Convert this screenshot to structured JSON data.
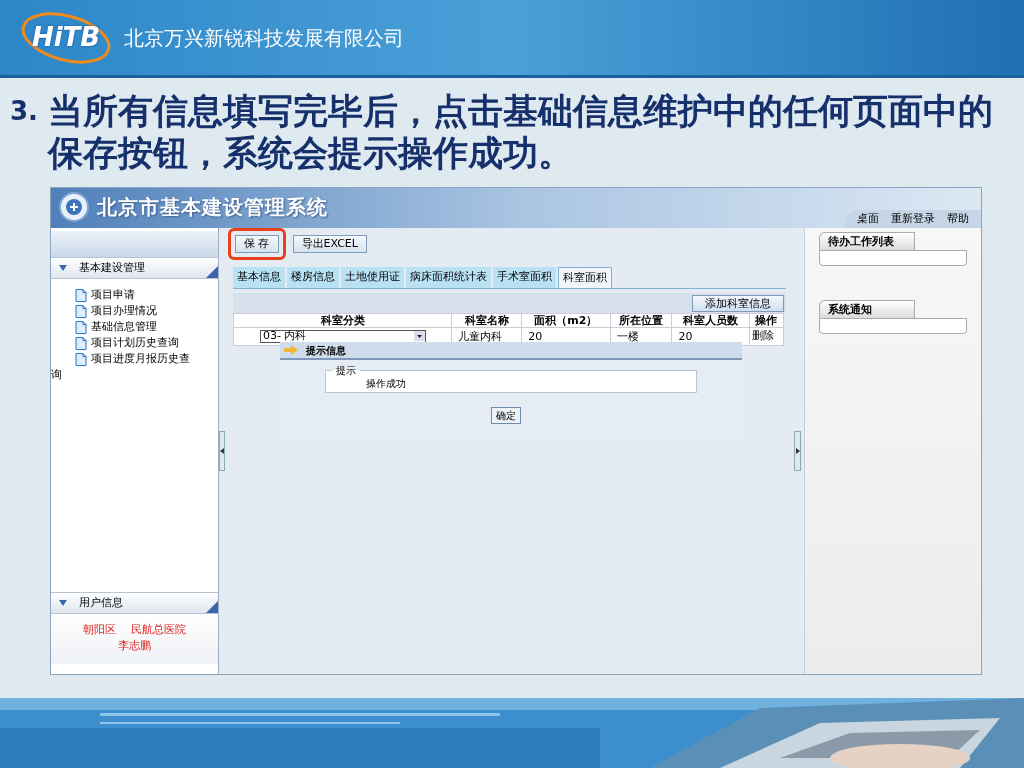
{
  "company": {
    "logo_text": "HiTB",
    "name": "北京万兴新锐科技发展有限公司"
  },
  "heading": {
    "number": "3.",
    "text": "当所有信息填写完毕后，点击基础信息维护中的任何页面中的保存按钮，系统会提示操作成功。"
  },
  "app": {
    "title": "北京市基本建设管理系统",
    "nav_links": [
      "桌面",
      "重新登录",
      "帮助"
    ],
    "sidebar": {
      "sections": [
        {
          "title": "基本建设管理",
          "expanded": true,
          "items": [
            "项目申请",
            "项目办理情况",
            "基础信息管理",
            "项目计划历史查询",
            "项目进度月报历史查询"
          ]
        }
      ],
      "user_section": {
        "title": "用户信息",
        "expanded": true,
        "lines": [
          "朝阳区　 民航总医院",
          "李志鹏"
        ]
      }
    },
    "toolbar": [
      {
        "label": "保 存",
        "highlighted": true
      },
      {
        "label": "导出EXCEL",
        "highlighted": false
      }
    ],
    "tabs": [
      {
        "label": "基本信息",
        "selected": false
      },
      {
        "label": "楼房信息",
        "selected": false
      },
      {
        "label": "土地使用证",
        "selected": false
      },
      {
        "label": "病床面积统计表",
        "selected": false
      },
      {
        "label": "手术室面积",
        "selected": false
      },
      {
        "label": "科室面积",
        "selected": true
      }
    ],
    "add_button": "添加科室信息",
    "table": {
      "columns": [
        "科室分类",
        "科室名称",
        "面积（m2）",
        "所在位置",
        "科室人员数",
        "操作"
      ],
      "rows": [
        {
          "cells": [
            "03- 内科",
            "儿童内科",
            "20",
            "一楼",
            "20",
            "删除"
          ]
        }
      ]
    },
    "dialog": {
      "title": "提示信息",
      "group_label": "提示",
      "message": "操作成功",
      "ok_button": "确定"
    },
    "right_panels": [
      {
        "title": "待办工作列表"
      },
      {
        "title": "系统通知"
      }
    ]
  }
}
